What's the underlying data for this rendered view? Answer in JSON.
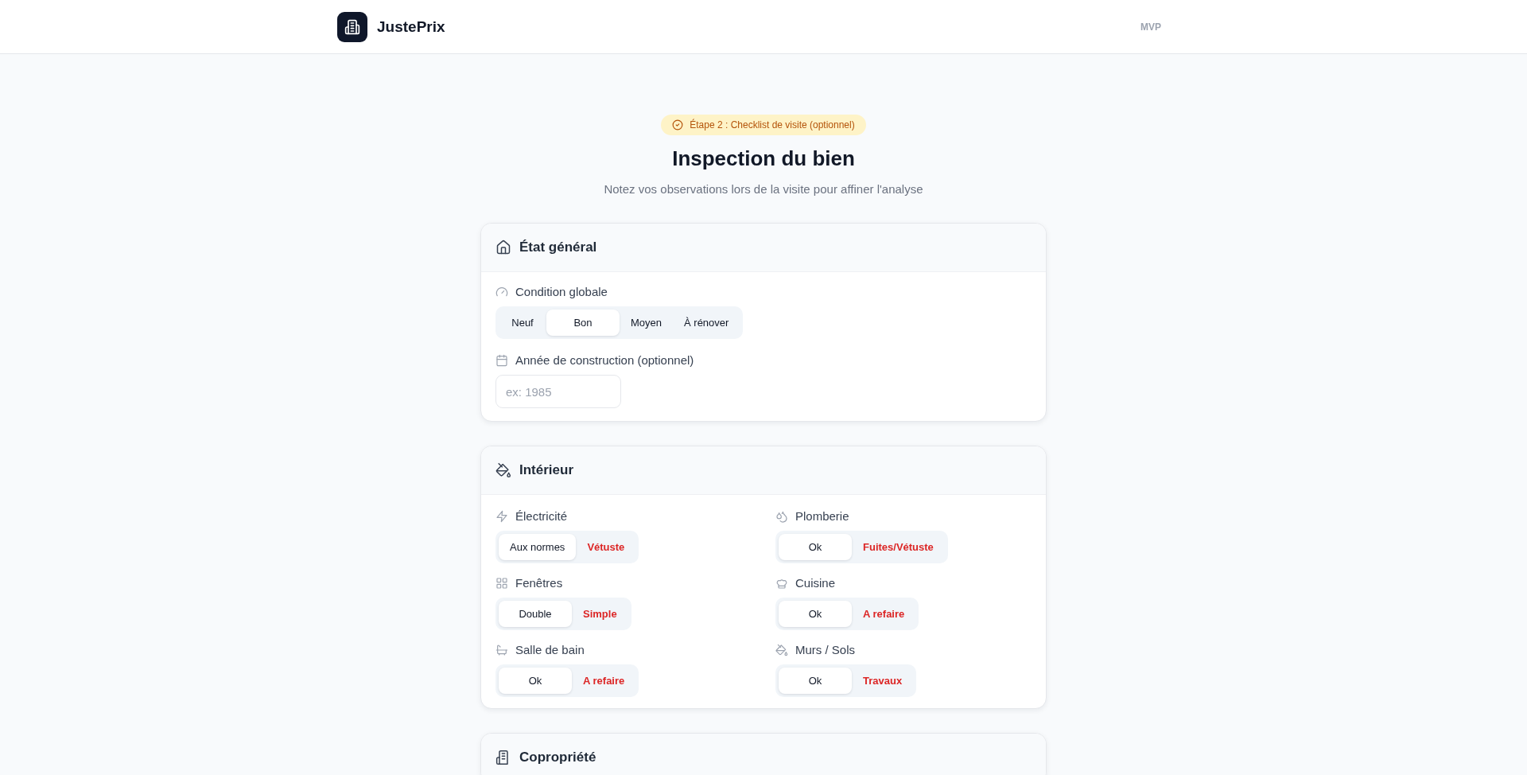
{
  "header": {
    "brand": "JustePrix",
    "tag": "MVP"
  },
  "step_badge": "Étape 2 : Checklist de visite (optionnel)",
  "title": "Inspection du bien",
  "subtitle": "Notez vos observations lors de la visite pour affiner l'analyse",
  "sections": [
    {
      "title": "État général",
      "kind": "stack",
      "fields": [
        {
          "kind": "segmented",
          "label": "Condition globale",
          "options": [
            {
              "label": "Neuf",
              "selected": false,
              "kind": "normal"
            },
            {
              "label": "Bon",
              "selected": true,
              "kind": "normal"
            },
            {
              "label": "Moyen",
              "selected": false,
              "kind": "normal"
            },
            {
              "label": "À rénover",
              "selected": false,
              "kind": "normal"
            }
          ]
        },
        {
          "kind": "input",
          "label": "Année de construction (optionnel)",
          "placeholder": "ex: 1985"
        }
      ]
    },
    {
      "title": "Intérieur",
      "kind": "grid",
      "fields": [
        {
          "kind": "segmented",
          "label": "Électricité",
          "options": [
            {
              "label": "Aux normes",
              "selected": true,
              "kind": "normal"
            },
            {
              "label": "Vétuste",
              "selected": false,
              "kind": "warning"
            }
          ]
        },
        {
          "kind": "segmented",
          "label": "Plomberie",
          "options": [
            {
              "label": "Ok",
              "selected": true,
              "kind": "normal"
            },
            {
              "label": "Fuites/Vétuste",
              "selected": false,
              "kind": "warning"
            }
          ]
        },
        {
          "kind": "segmented",
          "label": "Fenêtres",
          "options": [
            {
              "label": "Double",
              "selected": true,
              "kind": "normal"
            },
            {
              "label": "Simple",
              "selected": false,
              "kind": "warning"
            }
          ]
        },
        {
          "kind": "segmented",
          "label": "Cuisine",
          "options": [
            {
              "label": "Ok",
              "selected": true,
              "kind": "normal"
            },
            {
              "label": "A refaire",
              "selected": false,
              "kind": "warning"
            }
          ]
        },
        {
          "kind": "segmented",
          "label": "Salle de bain",
          "options": [
            {
              "label": "Ok",
              "selected": true,
              "kind": "normal"
            },
            {
              "label": "A refaire",
              "selected": false,
              "kind": "warning"
            }
          ]
        },
        {
          "kind": "segmented",
          "label": "Murs / Sols",
          "options": [
            {
              "label": "Ok",
              "selected": true,
              "kind": "normal"
            },
            {
              "label": "Travaux",
              "selected": false,
              "kind": "warning"
            }
          ]
        }
      ]
    },
    {
      "title": "Copropriété",
      "kind": "stack"
    }
  ]
}
